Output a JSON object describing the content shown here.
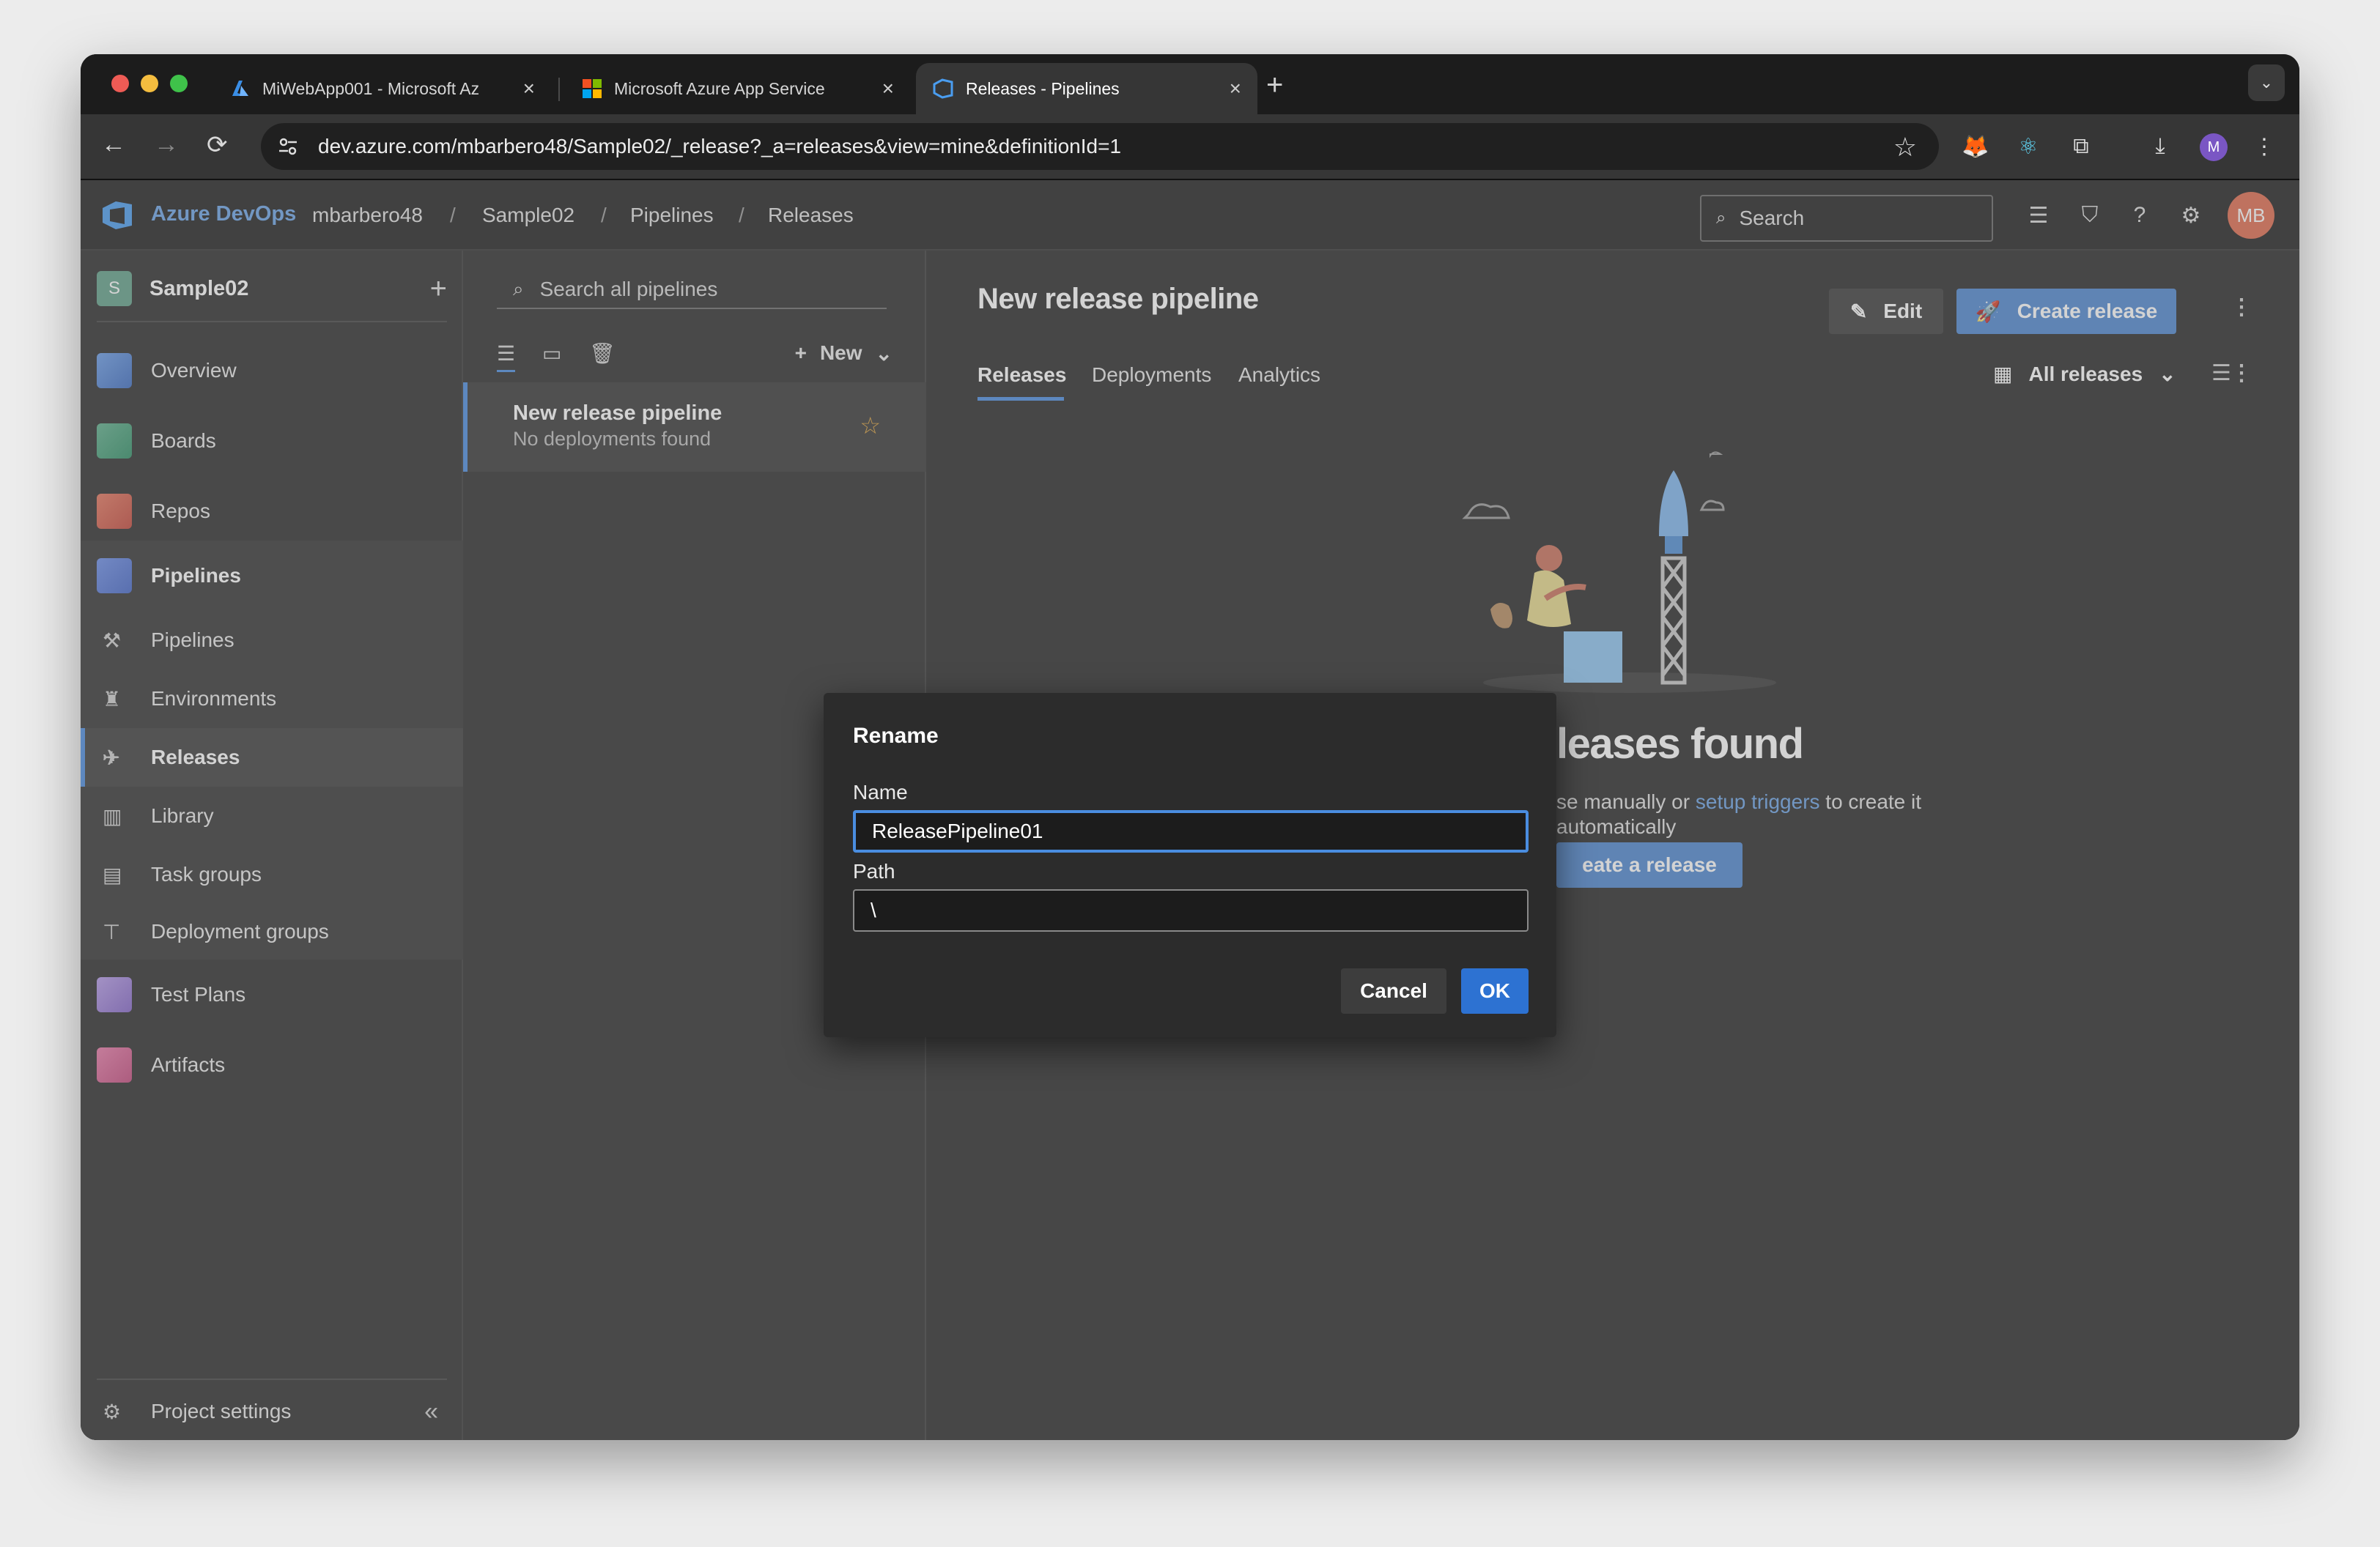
{
  "browser": {
    "tabs": [
      {
        "title": "MiWebApp001 - Microsoft Az",
        "icon": "azure-icon"
      },
      {
        "title": "Microsoft Azure App Service",
        "icon": "microsoft-icon"
      },
      {
        "title": "Releases - Pipelines",
        "icon": "azure-devops-icon",
        "active": true
      }
    ],
    "url": "dev.azure.com/mbarbero48/Sample02/_release?_a=releases&view=mine&definitionId=1",
    "profile_initial": "M"
  },
  "header": {
    "brand": "Azure DevOps",
    "breadcrumbs": [
      "mbarbero48",
      "Sample02",
      "Pipelines",
      "Releases"
    ],
    "search_label": "Search",
    "avatar_initials": "MB"
  },
  "sidebar": {
    "project_initial": "S",
    "project_name": "Sample02",
    "items": [
      {
        "label": "Overview",
        "icon": "overview-icon"
      },
      {
        "label": "Boards",
        "icon": "boards-icon"
      },
      {
        "label": "Repos",
        "icon": "repos-icon"
      },
      {
        "label": "Pipelines",
        "icon": "pipelines-icon"
      },
      {
        "label": "Pipelines",
        "icon": "pipelines-sub-icon"
      },
      {
        "label": "Environments",
        "icon": "environments-icon"
      },
      {
        "label": "Releases",
        "icon": "releases-icon"
      },
      {
        "label": "Library",
        "icon": "library-icon"
      },
      {
        "label": "Task groups",
        "icon": "task-groups-icon"
      },
      {
        "label": "Deployment groups",
        "icon": "deployment-groups-icon"
      },
      {
        "label": "Test Plans",
        "icon": "test-plans-icon"
      },
      {
        "label": "Artifacts",
        "icon": "artifacts-icon"
      }
    ],
    "project_settings": "Project settings"
  },
  "pipelines_list": {
    "search_placeholder": "Search all pipelines",
    "new_label": "New",
    "items": [
      {
        "title": "New release pipeline",
        "subtitle": "No deployments found"
      }
    ]
  },
  "main": {
    "title": "New release pipeline",
    "edit_label": "Edit",
    "create_release_label": "Create release",
    "tabs": [
      "Releases",
      "Deployments",
      "Analytics"
    ],
    "filter_label": "All releases",
    "empty_title": "leases found",
    "empty_desc_prefix": "se manually or ",
    "empty_desc_link": "setup triggers",
    "empty_desc_suffix": " to create it",
    "empty_desc_line2": "automatically",
    "empty_cta": "eate a release"
  },
  "dialog": {
    "title": "Rename",
    "name_label": "Name",
    "name_value": "ReleasePipeline01",
    "path_label": "Path",
    "path_value": "\\",
    "cancel_label": "Cancel",
    "ok_label": "OK"
  },
  "colors": {
    "accent": "#4a8de0",
    "primary_button": "#2d72d2",
    "brand_text": "#6aa3e6",
    "avatar": "#e06a4d"
  }
}
